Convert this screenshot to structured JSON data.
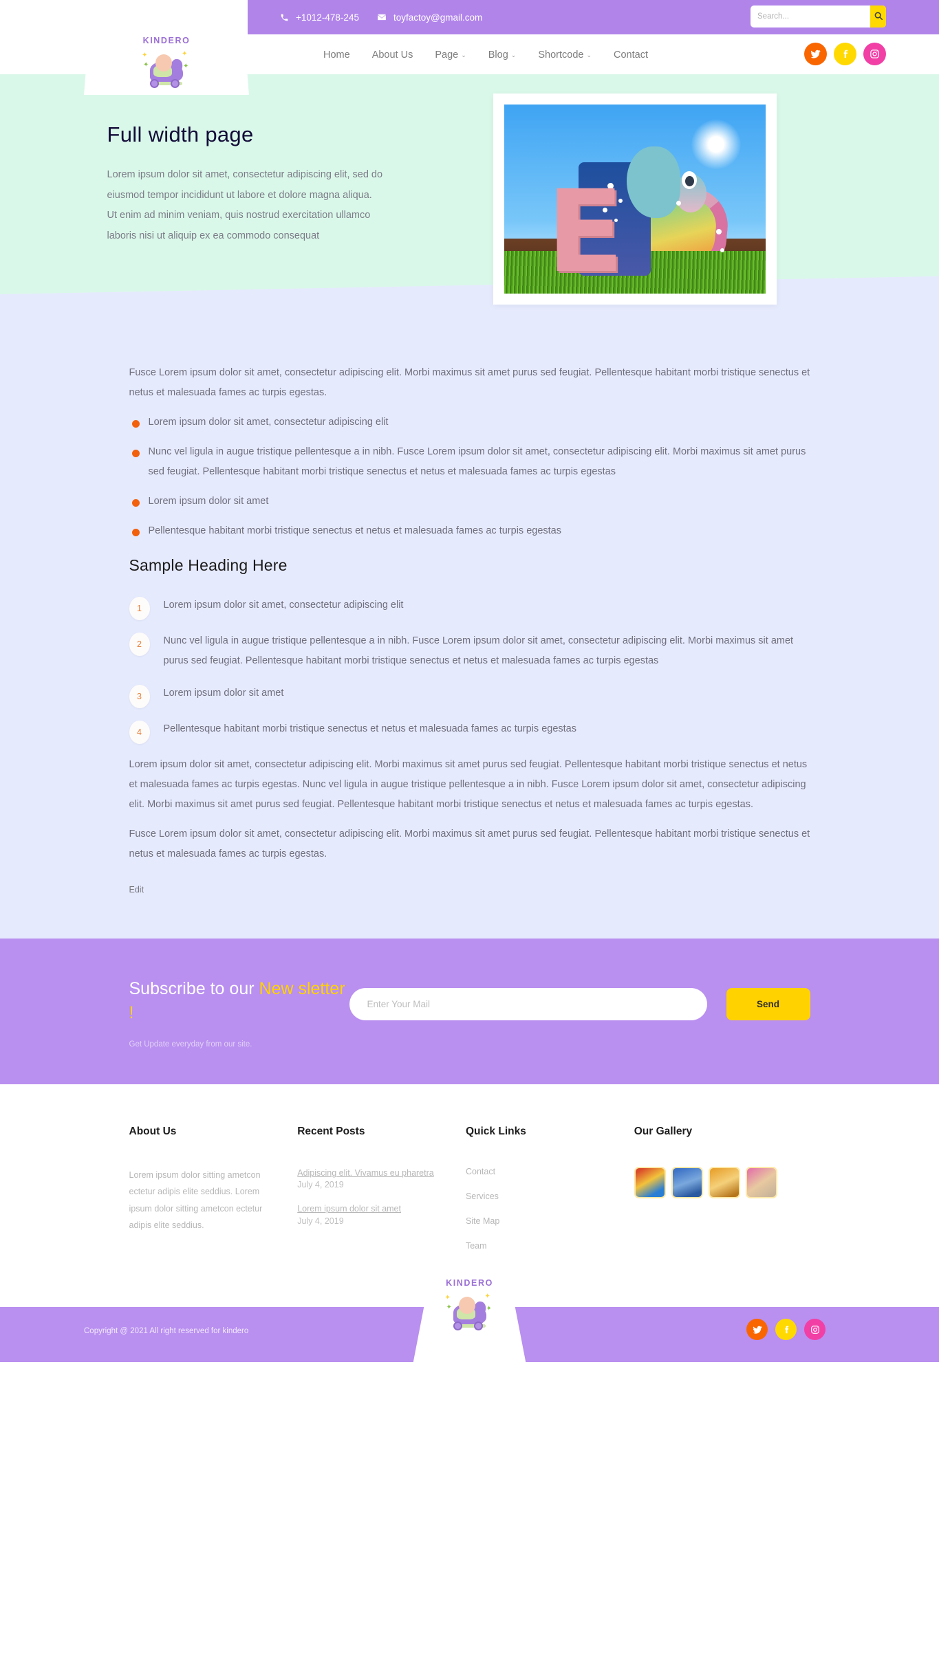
{
  "topbar": {
    "phone": "+1012-478-245",
    "email": "toyfactoy@gmail.com",
    "phone_icon": "phone-icon",
    "email_icon": "envelope-icon",
    "search_placeholder": "Search...",
    "search_value": "",
    "search_icon": "search-icon"
  },
  "brand": {
    "name": "KINDERO",
    "logo_icon": "baby-on-rocking-horse-logo"
  },
  "nav": {
    "items": [
      {
        "label": "Home",
        "has_dropdown": false
      },
      {
        "label": "About Us",
        "has_dropdown": false
      },
      {
        "label": "Page",
        "has_dropdown": true
      },
      {
        "label": "Blog",
        "has_dropdown": true
      },
      {
        "label": "Shortcode",
        "has_dropdown": true
      },
      {
        "label": "Contact",
        "has_dropdown": false
      }
    ],
    "caret": "⌄"
  },
  "social": [
    {
      "name": "twitter",
      "icon": "twitter-icon",
      "color": "#f96600"
    },
    {
      "name": "facebook",
      "icon": "facebook-icon",
      "color": "#ffd900"
    },
    {
      "name": "instagram",
      "icon": "instagram-icon",
      "color": "#f13fa6"
    }
  ],
  "hero": {
    "title": "Full width page",
    "text": "Lorem ipsum dolor sit amet, consectetur adipiscing elit, sed do eiusmod tempor incididunt ut labore et dolore magna aliqua. Ut enim ad minim veniam, quis nostrud exercitation ullamco laboris nisi ut aliquip ex ea commodo consequat",
    "image_alt": "3D letter E with rainbow elephant standing on grass under blue sky",
    "bg_color": "#daf8e9"
  },
  "content": {
    "bg_color": "#e6eafd",
    "intro": "Fusce Lorem ipsum dolor sit amet, consectetur adipiscing elit. Morbi maximus sit amet purus sed feugiat. Pellentesque habitant morbi tristique senectus et netus et malesuada fames ac turpis egestas.",
    "bullets": [
      "Lorem ipsum dolor sit amet, consectetur adipiscing elit",
      "Nunc vel ligula in augue tristique pellentesque a in nibh. Fusce Lorem ipsum dolor sit amet, consectetur adipiscing elit. Morbi maximus sit amet purus sed feugiat. Pellentesque habitant morbi tristique senectus et netus et malesuada fames ac turpis egestas",
      "Lorem ipsum dolor sit amet",
      "Pellentesque habitant morbi tristique senectus et netus et malesuada fames ac turpis egestas"
    ],
    "bullet_color": "#f2600c",
    "heading": "Sample Heading Here",
    "numbered": [
      {
        "n": "1",
        "text": "Lorem ipsum dolor sit amet, consectetur adipiscing elit"
      },
      {
        "n": "2",
        "text": "Nunc vel ligula in augue tristique pellentesque a in nibh. Fusce Lorem ipsum dolor sit amet, consectetur adipiscing elit. Morbi maximus sit amet purus sed feugiat. Pellentesque habitant morbi tristique senectus et netus et malesuada fames ac turpis egestas"
      },
      {
        "n": "3",
        "text": "Lorem ipsum dolor sit amet"
      },
      {
        "n": "4",
        "text": "Pellentesque habitant morbi tristique senectus et netus et malesuada fames ac turpis egestas"
      }
    ],
    "para1": "Lorem ipsum dolor sit amet, consectetur adipiscing elit. Morbi maximus sit amet purus sed feugiat. Pellentesque habitant morbi tristique senectus et netus et malesuada fames ac turpis egestas. Nunc vel ligula in augue tristique pellentesque a in nibh. Fusce Lorem ipsum dolor sit amet, consectetur adipiscing elit. Morbi maximus sit amet purus sed feugiat. Pellentesque habitant morbi tristique senectus et netus et malesuada fames ac turpis egestas.",
    "para2": "Fusce Lorem ipsum dolor sit amet, consectetur adipiscing elit. Morbi maximus sit amet purus sed feugiat. Pellentesque habitant morbi tristique senectus et netus et malesuada fames ac turpis egestas.",
    "edit_label": "Edit"
  },
  "newsletter": {
    "title_part1": "Subscribe to our ",
    "title_highlight": "New sletter !",
    "subtitle": "Get Update everyday from our site.",
    "input_placeholder": "Enter Your Mail",
    "input_value": "",
    "button_label": "Send",
    "bg_color": "#b98ff0",
    "highlight_color": "#ffd200"
  },
  "footer": {
    "about": {
      "title": "About Us",
      "text": "Lorem ipsum dolor sitting ametcon ectetur adipis elite seddius. Lorem ipsum dolor sitting ametcon ectetur adipis elite seddius."
    },
    "recent_posts": {
      "title": "Recent Posts",
      "items": [
        {
          "text": "Adipiscing elit. Vivamus eu pharetra",
          "date": "July 4, 2019"
        },
        {
          "text": "Lorem ipsum dolor sit amet",
          "date": "July 4, 2019"
        }
      ]
    },
    "quick_links": {
      "title": "Quick Links",
      "items": [
        "Contact",
        "Services",
        "Site Map",
        "Team"
      ]
    },
    "gallery": {
      "title": "Our Gallery",
      "items": [
        {
          "alt": "colorful ball pit play area"
        },
        {
          "alt": "blue playhouse classroom"
        },
        {
          "alt": "orange classroom with table"
        },
        {
          "alt": "children in party hats"
        }
      ]
    }
  },
  "bottom": {
    "copyright": "Copyright @ 2021 All right reserved for kindero"
  }
}
